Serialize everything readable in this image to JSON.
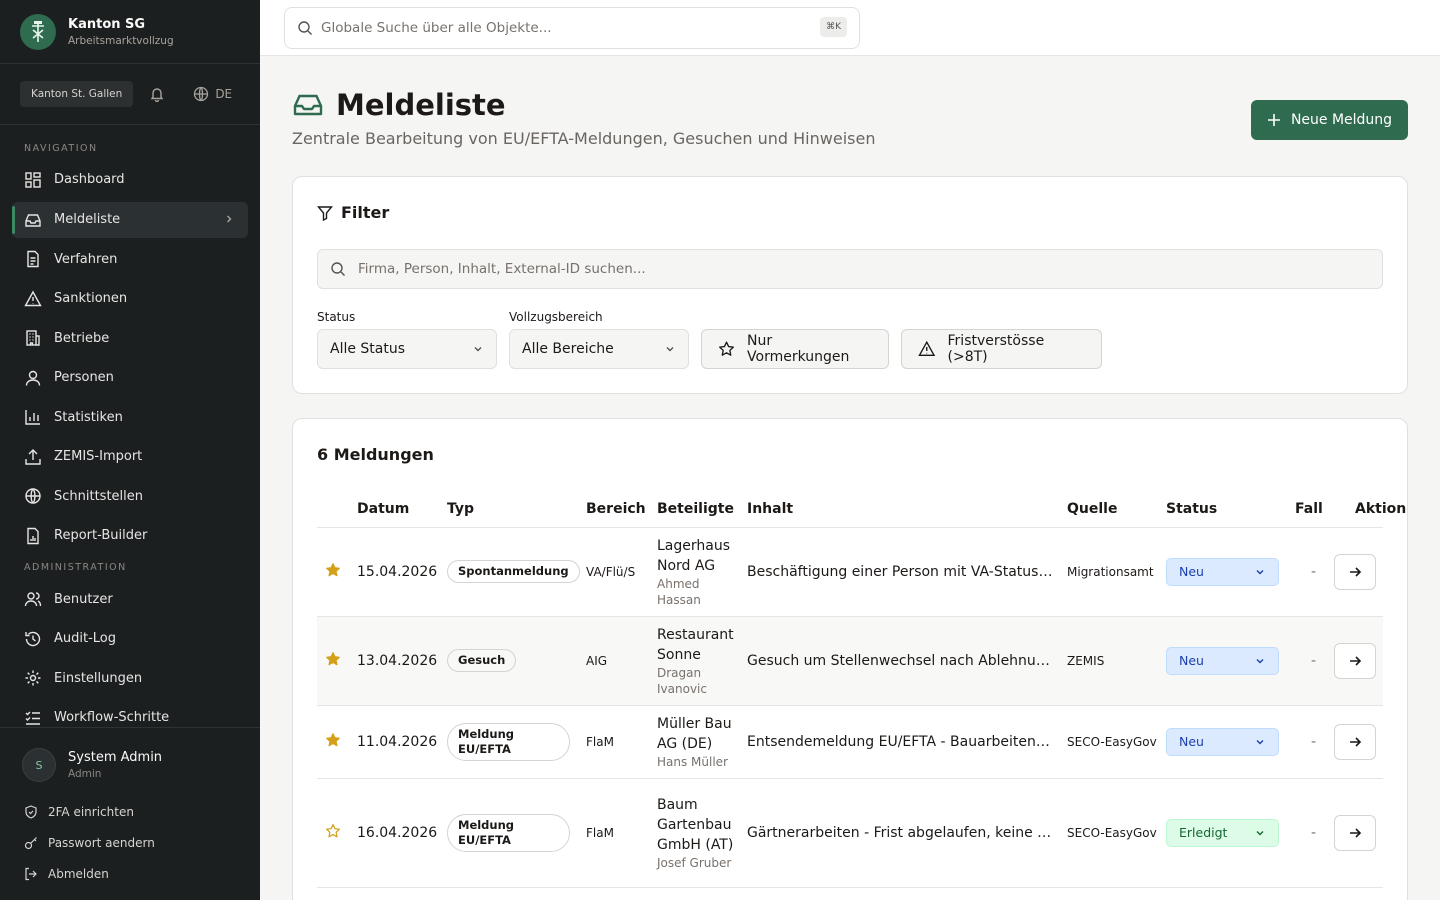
{
  "brand": {
    "title": "Kanton SG",
    "subtitle": "Arbeitsmarktvollzug"
  },
  "topctrl": {
    "canton": "Kanton St. Gallen",
    "lang": "DE"
  },
  "nav": {
    "section_navigation": "NAVIGATION",
    "items": [
      {
        "label": "Dashboard",
        "icon": "dashboard-icon"
      },
      {
        "label": "Meldeliste",
        "icon": "inbox-icon",
        "active": true
      },
      {
        "label": "Verfahren",
        "icon": "file-text-icon"
      },
      {
        "label": "Sanktionen",
        "icon": "warning-icon"
      },
      {
        "label": "Betriebe",
        "icon": "building-icon"
      },
      {
        "label": "Personen",
        "icon": "user-icon"
      },
      {
        "label": "Statistiken",
        "icon": "chart-icon"
      },
      {
        "label": "ZEMIS-Import",
        "icon": "upload-icon"
      },
      {
        "label": "Schnittstellen",
        "icon": "globe-icon"
      },
      {
        "label": "Report-Builder",
        "icon": "report-icon"
      }
    ],
    "section_admin": "ADMINISTRATION",
    "admin_items": [
      {
        "label": "Benutzer",
        "icon": "users-icon"
      },
      {
        "label": "Audit-Log",
        "icon": "history-icon"
      },
      {
        "label": "Einstellungen",
        "icon": "gear-icon"
      },
      {
        "label": "Workflow-Schritte",
        "icon": "list-check-icon"
      }
    ]
  },
  "user": {
    "initial": "S",
    "name": "System Admin",
    "role": "Admin"
  },
  "account": {
    "twofa": "2FA einrichten",
    "password": "Passwort aendern",
    "logout": "Abmelden"
  },
  "search": {
    "placeholder": "Globale Suche über alle Objekte...",
    "shortcut": "⌘K"
  },
  "page": {
    "title": "Meldeliste",
    "subtitle": "Zentrale Bearbeitung von EU/EFTA-Meldungen, Gesuchen und Hinweisen",
    "new_button": "Neue Meldung"
  },
  "filter": {
    "title": "Filter",
    "search_placeholder": "Firma, Person, Inhalt, External-ID suchen...",
    "status_label": "Status",
    "status_value": "Alle Status",
    "area_label": "Vollzugsbereich",
    "area_value": "Alle Bereiche",
    "only_marked": "Nur Vormerkungen",
    "deadline": "Fristverstösse (>8T)"
  },
  "list": {
    "count": "6 Meldungen",
    "columns": [
      "Datum",
      "Typ",
      "Bereich",
      "Beteiligte",
      "Inhalt",
      "Quelle",
      "Status",
      "Fall",
      "Aktionen"
    ],
    "rows": [
      {
        "starred": true,
        "date": "15.04.2026",
        "type": "Spontanmeldung",
        "area": "VA/Flü/S",
        "firm": "Lagerhaus Nord AG",
        "person": "Ahmed Hassan",
        "content": "Beschäftigung einer Person mit VA-Status ohne Bewilligung",
        "source": "Migrationsamt",
        "status": "Neu",
        "case": "-"
      },
      {
        "starred": true,
        "date": "13.04.2026",
        "type": "Gesuch",
        "area": "AIG",
        "firm": "Restaurant Sonne",
        "person": "Dragan Ivanovic",
        "content": "Gesuch um Stellenwechsel nach Ablehnung der Bewilligung",
        "source": "ZEMIS",
        "status": "Neu",
        "case": "-"
      },
      {
        "starred": true,
        "date": "11.04.2026",
        "type": "Meldung EU/EFTA",
        "area": "FlaM",
        "firm": "Müller Bau AG (DE)",
        "person": "Hans Müller",
        "content": "Entsendemeldung EU/EFTA - Bauarbeiten in St. Gallen",
        "source": "SECO-EasyGov",
        "status": "Neu",
        "case": "-"
      },
      {
        "starred": false,
        "date": "16.04.2026",
        "type": "Meldung EU/EFTA",
        "area": "FlaM",
        "firm": "Baum Gartenbau GmbH (AT)",
        "person": "Josef Gruber",
        "content": "Gärtnerarbeiten - Frist abgelaufen, keine weitere Meldung",
        "source": "SECO-EasyGov",
        "status": "Erledigt",
        "case": "-"
      }
    ]
  },
  "colors": {
    "accent": "#2f6b4f",
    "sidebar": "#1c1f20",
    "star": "#d4a017"
  }
}
